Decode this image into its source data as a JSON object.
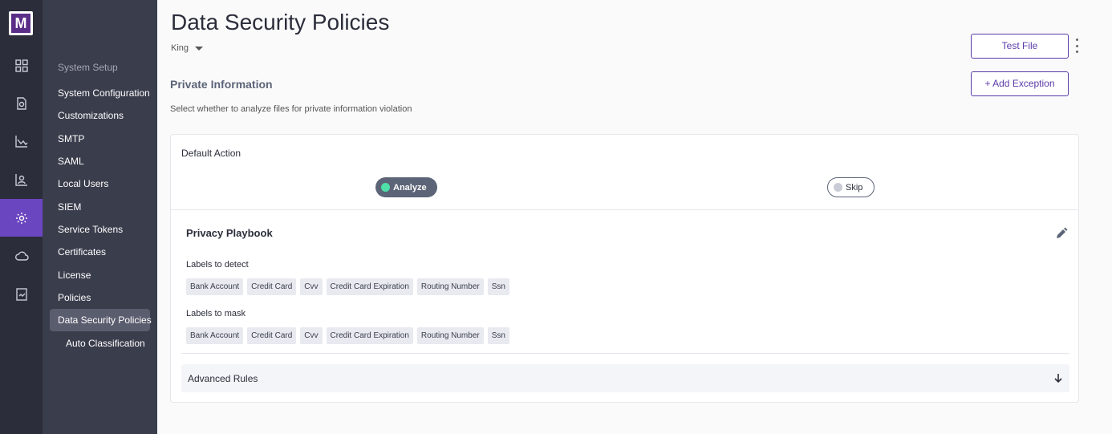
{
  "logo": {
    "letter": "M"
  },
  "rail": {
    "icons": [
      "dashboard-icon",
      "file-shield-icon",
      "analytics-icon",
      "users-chart-icon",
      "gear-icon",
      "cloud-icon",
      "report-icon"
    ],
    "active": "gear-icon",
    "accent_color": "#6b46c1"
  },
  "sidebar": {
    "heading": "System Setup",
    "items": [
      {
        "label": "System Configuration"
      },
      {
        "label": "Customizations"
      },
      {
        "label": "SMTP"
      },
      {
        "label": "SAML"
      },
      {
        "label": "Local Users"
      },
      {
        "label": "SIEM"
      },
      {
        "label": "Service Tokens"
      },
      {
        "label": "Certificates"
      },
      {
        "label": "License"
      },
      {
        "label": "Policies"
      },
      {
        "label": "Data Security Policies"
      },
      {
        "label": "Auto Classification"
      }
    ]
  },
  "page": {
    "title": "Data Security Policies",
    "tenant": "King",
    "test_file_label": "Test File",
    "add_exception_label": "+ Add Exception",
    "section_title": "Private Information",
    "section_subtitle": "Select whether to analyze files for private information violation"
  },
  "default_action": {
    "label": "Default Action",
    "analyze_label": "Analyze",
    "skip_label": "Skip",
    "selected": "Analyze",
    "analyze_dot_color": "#4ee0a8",
    "skip_dot_color": "#c9ccd6"
  },
  "playbook": {
    "title": "Privacy Playbook",
    "detect_label": "Labels to detect",
    "detect_labels": [
      "Bank Account",
      "Credit Card",
      "Cvv",
      "Credit Card Expiration",
      "Routing Number",
      "Ssn"
    ],
    "mask_label": "Labels to mask",
    "mask_labels": [
      "Bank Account",
      "Credit Card",
      "Cvv",
      "Credit Card Expiration",
      "Routing Number",
      "Ssn"
    ]
  },
  "advanced": {
    "label": "Advanced Rules"
  }
}
